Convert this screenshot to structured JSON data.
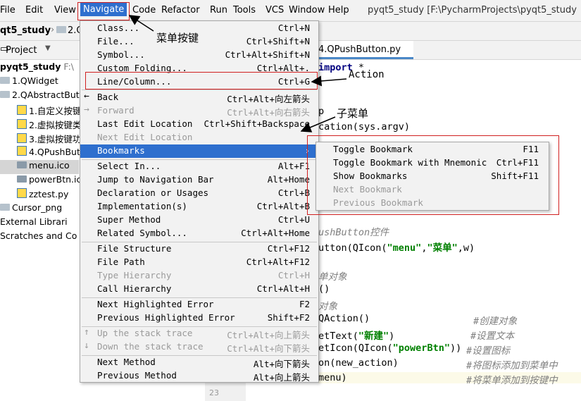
{
  "menubar": {
    "items": [
      "File",
      "Edit",
      "View",
      "Navigate",
      "Code",
      "Refactor",
      "Run",
      "Tools",
      "VCS",
      "Window",
      "Help"
    ],
    "title": "pyqt5_study [F:\\PycharmProjects\\pyqt5_study"
  },
  "breadcrumb": [
    "qt5_study",
    "2.Q"
  ],
  "project": {
    "header": "Project",
    "tree": [
      {
        "label": "pyqt5_study",
        "suffix": "F:\\",
        "type": "root"
      },
      {
        "label": "1.QWidget",
        "type": "dir"
      },
      {
        "label": "2.QAbstractBut",
        "type": "dir"
      },
      {
        "label": "1.自定义按键",
        "type": "py"
      },
      {
        "label": "2.虚拟按键类",
        "type": "py"
      },
      {
        "label": "3.虚拟按键功",
        "type": "py"
      },
      {
        "label": "4.QPushButt",
        "type": "py"
      },
      {
        "label": "menu.ico",
        "type": "file"
      },
      {
        "label": "powerBtn.ic",
        "type": "file"
      },
      {
        "label": "zztest.py",
        "type": "py"
      },
      {
        "label": "Cursor_png",
        "type": "dir"
      },
      {
        "label": "External Librari",
        "type": "lib"
      },
      {
        "label": "Scratches and Co",
        "type": "lib"
      }
    ]
  },
  "editor": {
    "tab": "4.QPushButton.py",
    "line_number": "23",
    "code": [
      {
        "parts": [
          [
            "t",
            ""
          ],
          [
            "kw",
            "import"
          ],
          [
            "t",
            " *"
          ]
        ]
      },
      {
        "parts": [
          [
            "t",
            "p"
          ]
        ]
      },
      {
        "parts": [
          [
            "t",
            "cation(sys.argv)"
          ]
        ]
      },
      {
        "parts": [
          [
            "cmt",
            "ushButton控件"
          ]
        ]
      },
      {
        "parts": [
          [
            "t",
            "utton(QIcon("
          ],
          [
            "str",
            "\"menu\""
          ],
          [
            "t",
            ","
          ],
          [
            "str",
            "\"菜单\""
          ],
          [
            "t",
            ",w)"
          ]
        ]
      },
      {
        "parts": [
          [
            "cmt",
            "单对象"
          ]
        ]
      },
      {
        "parts": [
          [
            "t",
            "()"
          ]
        ]
      },
      {
        "parts": [
          [
            "cmt",
            "对象"
          ]
        ]
      },
      {
        "parts": [
          [
            "t",
            " QAction()"
          ]
        ]
      },
      {
        "parts": [
          [
            "t",
            "etText("
          ],
          [
            "str",
            "\"新建\""
          ],
          [
            "t",
            ")"
          ]
        ]
      },
      {
        "parts": [
          [
            "t",
            "etIcon(QIcon("
          ],
          [
            "str",
            "\"powerBtn\""
          ],
          [
            "t",
            "))"
          ]
        ]
      },
      {
        "parts": [
          [
            "t",
            "on(new_action)"
          ]
        ]
      },
      {
        "parts": [
          [
            "t",
            "menu)"
          ]
        ]
      }
    ],
    "comments": [
      "#创建对象",
      "#设置文本",
      "#设置图标",
      "#将图标添加到菜单中",
      "#将菜单添加到按键中"
    ]
  },
  "navigate_menu": {
    "items": [
      {
        "label": "Class...",
        "shortcut": "Ctrl+N"
      },
      {
        "label": "File...",
        "shortcut": "Ctrl+Shift+N"
      },
      {
        "label": "Symbol...",
        "shortcut": "Ctrl+Alt+Shift+N"
      },
      {
        "label": "Custom Folding...",
        "shortcut": "Ctrl+Alt+."
      },
      {
        "label": "Line/Column...",
        "shortcut": "Ctrl+G"
      },
      {
        "separator": true
      },
      {
        "label": "Back",
        "shortcut": "Ctrl+Alt+向左箭头",
        "icon": "←"
      },
      {
        "label": "Forward",
        "shortcut": "Ctrl+Alt+向右箭头",
        "icon": "→",
        "disabled": true
      },
      {
        "label": "Last Edit Location",
        "shortcut": "Ctrl+Shift+Backspace"
      },
      {
        "label": "Next Edit Location",
        "shortcut": "",
        "disabled": true
      },
      {
        "label": "Bookmarks",
        "shortcut": "›",
        "selected": true
      },
      {
        "separator": true
      },
      {
        "label": "Select In...",
        "shortcut": "Alt+F1"
      },
      {
        "label": "Jump to Navigation Bar",
        "shortcut": "Alt+Home"
      },
      {
        "label": "Declaration or Usages",
        "shortcut": "Ctrl+B"
      },
      {
        "label": "Implementation(s)",
        "shortcut": "Ctrl+Alt+B"
      },
      {
        "label": "Super Method",
        "shortcut": "Ctrl+U"
      },
      {
        "label": "Related Symbol...",
        "shortcut": "Ctrl+Alt+Home"
      },
      {
        "separator": true
      },
      {
        "label": "File Structure",
        "shortcut": "Ctrl+F12"
      },
      {
        "label": "File Path",
        "shortcut": "Ctrl+Alt+F12"
      },
      {
        "label": "Type Hierarchy",
        "shortcut": "Ctrl+H",
        "disabled": true
      },
      {
        "label": "Call Hierarchy",
        "shortcut": "Ctrl+Alt+H"
      },
      {
        "separator": true
      },
      {
        "label": "Next Highlighted Error",
        "shortcut": "F2"
      },
      {
        "label": "Previous Highlighted Error",
        "shortcut": "Shift+F2"
      },
      {
        "separator": true
      },
      {
        "label": "Up the stack trace",
        "shortcut": "Ctrl+Alt+向上箭头",
        "icon": "↑",
        "disabled": true
      },
      {
        "label": "Down the stack trace",
        "shortcut": "Ctrl+Alt+向下箭头",
        "icon": "↓",
        "disabled": true
      },
      {
        "separator": true
      },
      {
        "label": "Next Method",
        "shortcut": "Alt+向下箭头"
      },
      {
        "label": "Previous Method",
        "shortcut": "Alt+向上箭头"
      }
    ]
  },
  "bookmarks_submenu": {
    "items": [
      {
        "label": "Toggle Bookmark",
        "shortcut": "F11"
      },
      {
        "label": "Toggle Bookmark with Mnemonic",
        "shortcut": "Ctrl+F11"
      },
      {
        "label": "Show Bookmarks",
        "shortcut": "Shift+F11"
      },
      {
        "label": "Next Bookmark",
        "shortcut": "",
        "disabled": true
      },
      {
        "label": "Previous Bookmark",
        "shortcut": "",
        "disabled": true
      }
    ]
  },
  "annotations": {
    "menu_button": "菜单按键",
    "action": "Action",
    "submenu": "子菜单"
  },
  "colors": {
    "accent": "#2e6fce",
    "annotation_box": "#d02020",
    "comment": "#808080",
    "string": "#008000",
    "keyword": "#000080"
  }
}
